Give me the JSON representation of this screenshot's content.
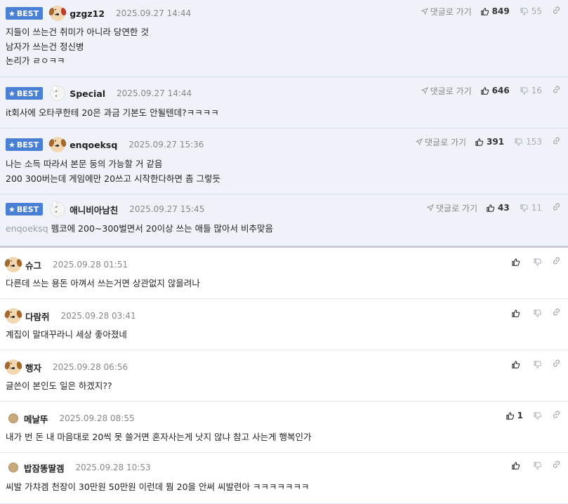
{
  "best_label": "BEST",
  "goto_label": "댓글로 가기",
  "comments": [
    {
      "best": true,
      "avatar": "dog-redbow",
      "nick": "gzgz12",
      "date": "2025.09.27 14:44",
      "lines": [
        "지들이 쓰는건 취미가 아니라 당연한 것",
        "남자가 쓰는건 정신병",
        "논리가 ㄹㅇㅋㅋ"
      ],
      "up": "849",
      "down": "55"
    },
    {
      "best": true,
      "avatar": "white-dog",
      "nick": "Special",
      "date": "2025.09.27 14:44",
      "lines": [
        "it회사에 오타쿠한테 20은 과금 기본도 안될텐데?ㅋㅋㅋㅋ"
      ],
      "up": "646",
      "down": "16"
    },
    {
      "best": true,
      "avatar": "dog",
      "nick": "enqoeksq",
      "date": "2025.09.27 15:36",
      "lines": [
        "나는 소득 따라서 본문 둥의 가능할 거 같음",
        "200 300버는데 게임에만 20쓰고 시작한다하면 좀 그렇듯"
      ],
      "up": "391",
      "down": "153"
    },
    {
      "best": true,
      "avatar": "white-dog",
      "nick": "애니비아남친",
      "date": "2025.09.27 15:45",
      "parent": "enqoeksq",
      "lines": [
        "펨코에 200~300벌면서 20이상 쓰는 애들 많아서 비추맞음"
      ],
      "up": "43",
      "down": "11"
    },
    {
      "best": false,
      "avatar": "dog",
      "nick": "슈그",
      "date": "2025.09.28 01:51",
      "lines": [
        "다른데 쓰는 용돈 아껴서 쓰는거면 상관없지 않을려나"
      ],
      "up": "",
      "down": ""
    },
    {
      "best": false,
      "avatar": "dog",
      "nick": "다람쥐",
      "date": "2025.09.28 03:41",
      "lines": [
        "계집이 말대꾸라니 세상 좋아졌네"
      ],
      "up": "",
      "down": ""
    },
    {
      "best": false,
      "avatar": "dog",
      "nick": "행자",
      "date": "2025.09.28 06:56",
      "lines": [
        "글쓴이 본인도 일은 하겠지??"
      ],
      "up": "",
      "down": ""
    },
    {
      "best": false,
      "avatar": "plain",
      "nick": "메날뚜",
      "date": "2025.09.28 08:55",
      "lines": [
        "내가 번 돈 내 마음대로 20씩 못 쓸거면 혼자사는게 낫지 않냐 참고 사는게 행복인가"
      ],
      "up": "1",
      "down": ""
    },
    {
      "best": false,
      "avatar": "plain",
      "nick": "밥잠똥딸겜",
      "date": "2025.09.28 10:53",
      "lines": [
        "씨발 가챠겜 천장이 30만원 50만원 이런데 뭠 20을 안써 씨발련아 ㅋㅋㅋㅋㅋㅋㅋ"
      ],
      "up": "",
      "down": ""
    }
  ]
}
